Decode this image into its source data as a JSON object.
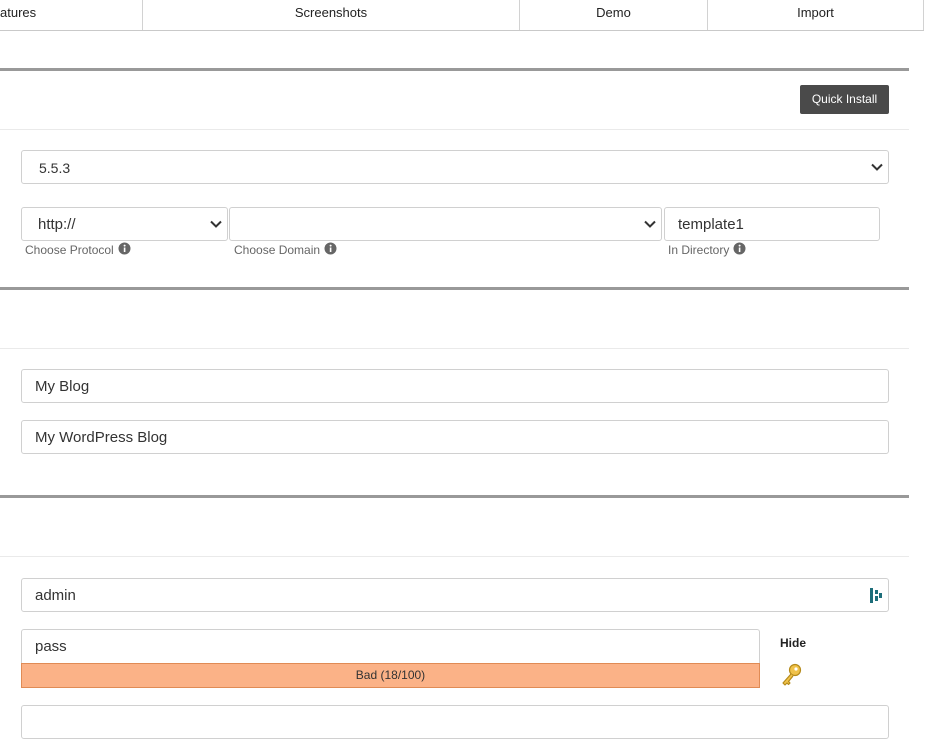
{
  "tabs": [
    "atures",
    "Screenshots",
    "Demo",
    "Import"
  ],
  "quick_install_label": "Quick Install",
  "version": {
    "value": "5.5.3"
  },
  "protocol": {
    "value": "http://",
    "label": "Choose Protocol"
  },
  "domain": {
    "value": "",
    "label": "Choose Domain"
  },
  "directory": {
    "value": "template1",
    "label": "In Directory"
  },
  "site_name": {
    "value": "My Blog"
  },
  "site_description": {
    "value": "My WordPress Blog"
  },
  "admin_username": {
    "value": "admin"
  },
  "admin_password": {
    "value": "pass"
  },
  "password_strength": {
    "label": "Bad (18/100)",
    "score": 18,
    "max": 100,
    "color": "#fbb287"
  },
  "hide_label": "Hide",
  "colors": {
    "section_rule": "#999999",
    "button_bg": "#4a4a4a"
  }
}
